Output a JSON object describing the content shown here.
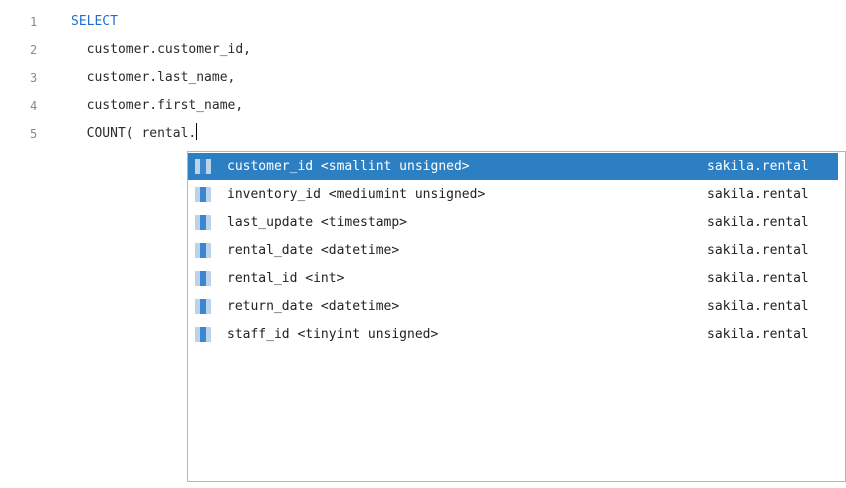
{
  "editor": {
    "lines": [
      {
        "number": "1",
        "code": "SELECT",
        "keyword": true
      },
      {
        "number": "2",
        "code": "  customer.customer_id,",
        "keyword": false
      },
      {
        "number": "3",
        "code": "  customer.last_name,",
        "keyword": false
      },
      {
        "number": "4",
        "code": "  customer.first_name,",
        "keyword": false
      },
      {
        "number": "5",
        "code": "  COUNT( rental.",
        "keyword": false
      }
    ]
  },
  "autocomplete": {
    "selected_index": 0,
    "items": [
      {
        "label": "customer_id <smallint unsigned>",
        "source": "sakila.rental",
        "icon": "column-icon"
      },
      {
        "label": "inventory_id <mediumint unsigned>",
        "source": "sakila.rental",
        "icon": "column-icon"
      },
      {
        "label": "last_update <timestamp>",
        "source": "sakila.rental",
        "icon": "column-icon"
      },
      {
        "label": "rental_date <datetime>",
        "source": "sakila.rental",
        "icon": "column-icon"
      },
      {
        "label": "rental_id <int>",
        "source": "sakila.rental",
        "icon": "column-icon"
      },
      {
        "label": "return_date <datetime>",
        "source": "sakila.rental",
        "icon": "column-icon"
      },
      {
        "label": "staff_id <tinyint unsigned>",
        "source": "sakila.rental",
        "icon": "column-icon"
      }
    ]
  },
  "colors": {
    "keyword": "#1f6fd1",
    "selection": "#2d7fc4",
    "line_number": "#8a8a8a"
  }
}
